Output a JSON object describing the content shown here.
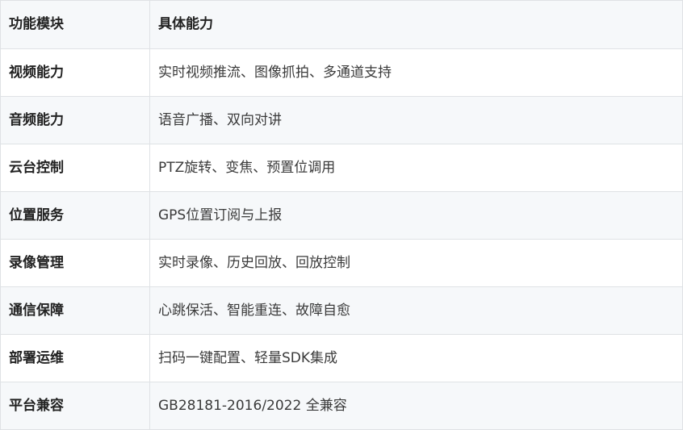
{
  "table": {
    "headers": {
      "module": "功能模块",
      "capability": "具体能力"
    },
    "rows": [
      {
        "module": "视频能力",
        "capability": "实时视频推流、图像抓拍、多通道支持"
      },
      {
        "module": "音频能力",
        "capability": "语音广播、双向对讲"
      },
      {
        "module": "云台控制",
        "capability": "PTZ旋转、变焦、预置位调用"
      },
      {
        "module": "位置服务",
        "capability": "GPS位置订阅与上报"
      },
      {
        "module": "录像管理",
        "capability": "实时录像、历史回放、回放控制"
      },
      {
        "module": "通信保障",
        "capability": "心跳保活、智能重连、故障自愈"
      },
      {
        "module": "部署运维",
        "capability": "扫码一键配置、轻量SDK集成"
      },
      {
        "module": "平台兼容",
        "capability": "GB28181-2016/2022 全兼容"
      }
    ]
  }
}
